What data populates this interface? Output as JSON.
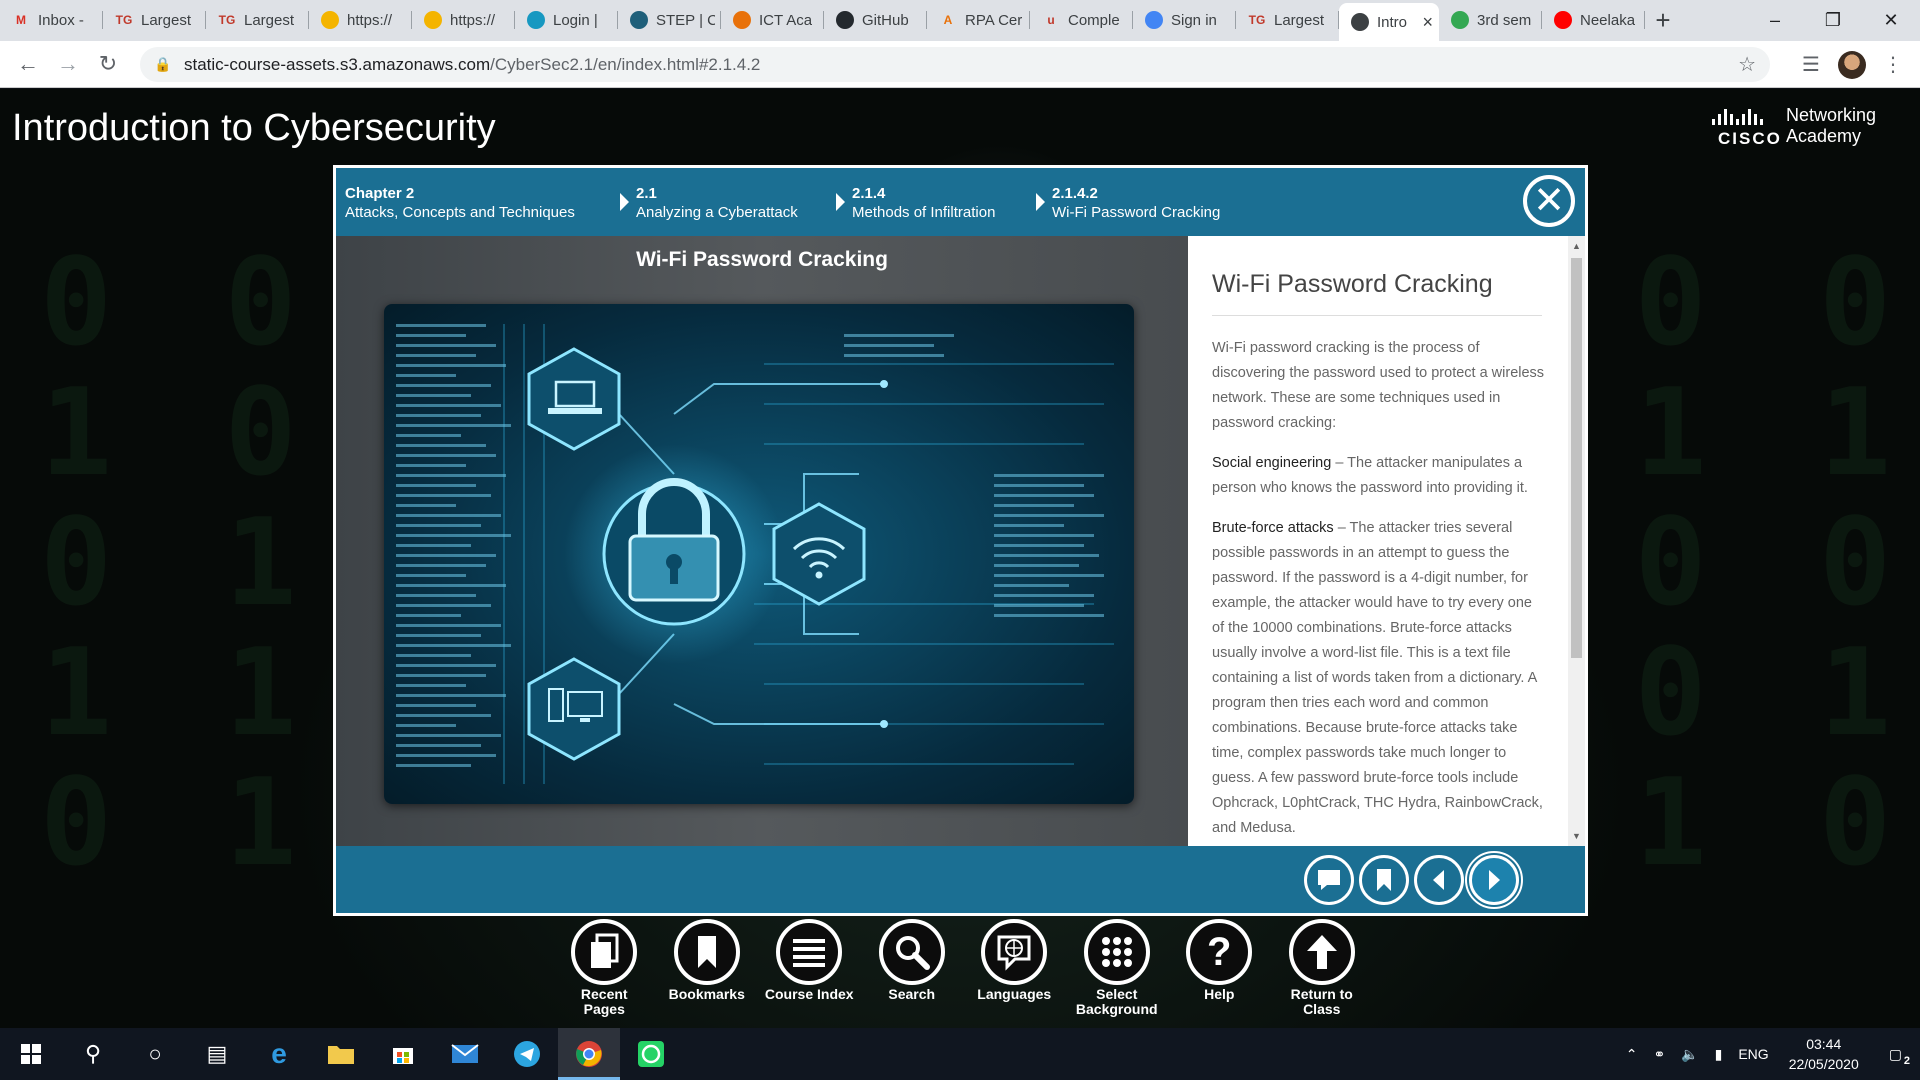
{
  "browser": {
    "tabs": [
      {
        "label": "Inbox -",
        "icon": "gmail-icon",
        "color": "#d93025",
        "glyph": "M"
      },
      {
        "label": "Largest",
        "icon": "tg-icon",
        "color": "#c0392b",
        "glyph": "TG"
      },
      {
        "label": "Largest",
        "icon": "tg-icon",
        "color": "#c0392b",
        "glyph": "TG"
      },
      {
        "label": "https://",
        "icon": "doc-icon",
        "color": "#f4b400",
        "glyph": ""
      },
      {
        "label": "https://",
        "icon": "doc-icon",
        "color": "#f4b400",
        "glyph": ""
      },
      {
        "label": "Login | ",
        "icon": "salesforce-icon",
        "color": "#1798c1",
        "glyph": ""
      },
      {
        "label": "STEP | C",
        "icon": "step-icon",
        "color": "#1f5f7a",
        "glyph": ""
      },
      {
        "label": "ICT Aca",
        "icon": "ict-icon",
        "color": "#e8710a",
        "glyph": ""
      },
      {
        "label": "GitHub",
        "icon": "github-icon",
        "color": "#24292e",
        "glyph": ""
      },
      {
        "label": "RPA Cer",
        "icon": "rpa-icon",
        "color": "#e8710a",
        "glyph": "A"
      },
      {
        "label": "Comple",
        "icon": "udemy-icon",
        "color": "#c0392b",
        "glyph": "u"
      },
      {
        "label": "Sign in",
        "icon": "cloud-icon",
        "color": "#4285f4",
        "glyph": ""
      },
      {
        "label": "Largest",
        "icon": "tg-icon",
        "color": "#c0392b",
        "glyph": "TG"
      },
      {
        "label": "Intro",
        "icon": "globe-icon",
        "color": "#3c4043",
        "glyph": "",
        "active": true
      },
      {
        "label": "3rd sem",
        "icon": "drive-icon",
        "color": "#34a853",
        "glyph": ""
      },
      {
        "label": "Neelaka",
        "icon": "youtube-icon",
        "color": "#ff0000",
        "glyph": ""
      }
    ],
    "url_host": "static-course-assets.s3.amazonaws.com",
    "url_path": "/CyberSec2.1/en/index.html#2.1.4.2"
  },
  "page": {
    "title": "Introduction to Cybersecurity",
    "logo_word": "CISCO",
    "logo_line1": "Networking",
    "logo_line2": "Academy"
  },
  "breadcrumb": [
    {
      "num": "Chapter 2",
      "title": "Attacks, Concepts and Techniques"
    },
    {
      "num": "2.1",
      "title": "Analyzing a Cyberattack"
    },
    {
      "num": "2.1.4",
      "title": "Methods of Infiltration"
    },
    {
      "num": "2.1.4.2",
      "title": "Wi-Fi Password Cracking"
    }
  ],
  "media": {
    "title": "Wi-Fi Password Cracking"
  },
  "article": {
    "heading": "Wi-Fi Password Cracking",
    "intro": "Wi-Fi password cracking is the process of discovering the password used to protect a wireless network. These are some techniques used in password cracking:",
    "social_term": "Social engineering",
    "social_text": " – The attacker manipulates a person who knows the password into providing it.",
    "brute_term": "Brute-force attacks",
    "brute_text": " – The attacker tries several possible passwords in an attempt to guess the password. If the password is a 4-digit number, for example, the attacker would have to try every one of the 10000 combinations. Brute-force attacks usually involve a word-list file. This is a text file containing a list of words taken from a dictionary. A program then tries each word and common combinations. Because brute-force attacks take time, complex passwords take much longer to guess. A few password brute-force tools include Ophcrack, L0phtCrack, THC Hydra, RainbowCrack, and Medusa."
  },
  "dock": [
    {
      "label": "Recent Pages",
      "icon": "recent-pages-icon"
    },
    {
      "label": "Bookmarks",
      "icon": "bookmark-icon"
    },
    {
      "label": "Course Index",
      "icon": "course-index-icon"
    },
    {
      "label": "Search",
      "icon": "search-icon"
    },
    {
      "label": "Languages",
      "icon": "languages-icon"
    },
    {
      "label": "Select Background",
      "icon": "select-background-icon"
    },
    {
      "label": "Help",
      "icon": "help-icon"
    },
    {
      "label": "Return to Class",
      "icon": "return-to-class-icon"
    }
  ],
  "taskbar": {
    "language": "ENG",
    "time": "03:44",
    "date": "22/05/2020",
    "notification_count": "2"
  },
  "colors": {
    "modal_header": "#1b6f93",
    "accent": "#1b9bd1"
  }
}
